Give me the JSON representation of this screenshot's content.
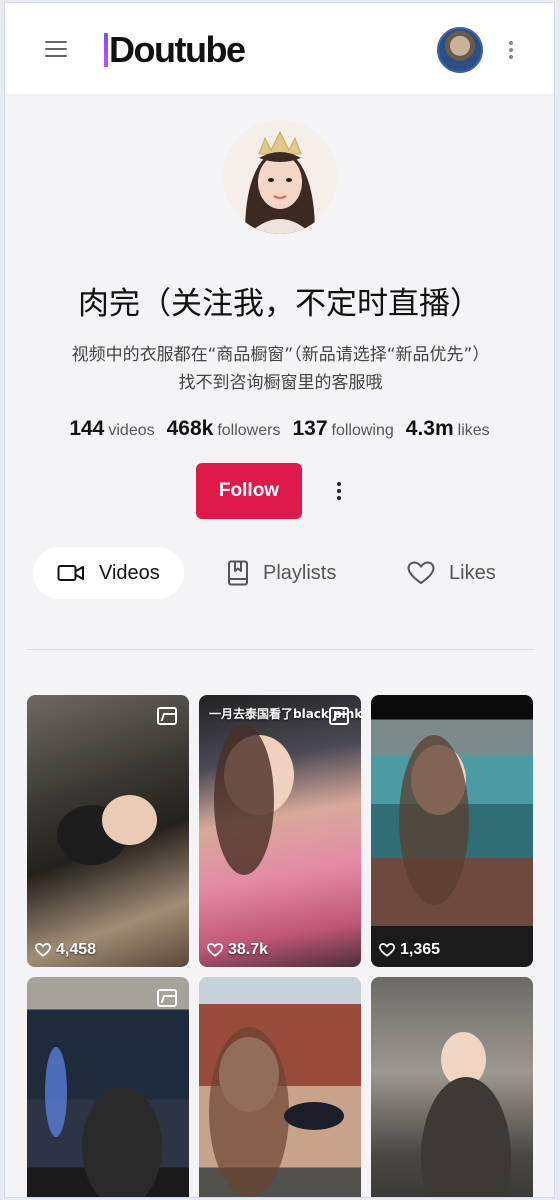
{
  "header": {
    "menu_icon": "hamburger-icon",
    "logo_text": "Doutube",
    "more_icon": "kebab-icon"
  },
  "profile": {
    "name": "肉完（关注我，不定时直播）",
    "bio_line1": "视频中的衣服都在“商品橱窗”（新品请选择“新品优先”）",
    "bio_line2": "找不到咨询橱窗里的客服哦",
    "stats": [
      {
        "value": "144",
        "label": "videos"
      },
      {
        "value": "468k",
        "label": "followers"
      },
      {
        "value": "137",
        "label": "following"
      },
      {
        "value": "4.3m",
        "label": "likes"
      }
    ],
    "follow_label": "Follow"
  },
  "tabs": [
    {
      "label": "Videos",
      "icon": "video-camera-icon",
      "active": true
    },
    {
      "label": "Playlists",
      "icon": "bookmark-book-icon",
      "active": false
    },
    {
      "label": "Likes",
      "icon": "heart-icon",
      "active": false
    }
  ],
  "videos": [
    {
      "likes": "4,458",
      "icon": "image-icon",
      "caption": ""
    },
    {
      "likes": "38.7k",
      "icon": "image-icon",
      "caption": "一月去泰国看了black pink"
    },
    {
      "likes": "1,365",
      "icon": "",
      "caption": ""
    },
    {
      "likes": "",
      "icon": "image-icon",
      "caption": ""
    },
    {
      "likes": "",
      "icon": "",
      "caption": ""
    },
    {
      "likes": "",
      "icon": "",
      "caption": ""
    }
  ],
  "colors": {
    "accent": "#e0194b",
    "page_bg": "#f4f4f6",
    "header_bg": "#ffffff"
  }
}
